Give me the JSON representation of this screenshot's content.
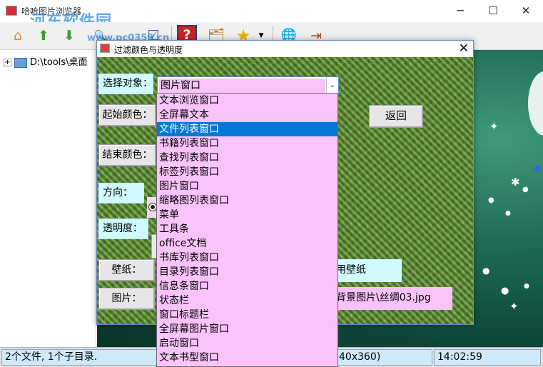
{
  "app": {
    "title": "哈哈图片浏览器",
    "watermark": "河东软件园",
    "watermark_url": "www.pc0359.cn"
  },
  "window_controls": {
    "minimize": "─",
    "maximize": "☐",
    "close": "✕"
  },
  "toolbar": {
    "buttons": [
      {
        "icon": "home-icon",
        "glyph": "⌂"
      },
      {
        "icon": "up-arrow-icon",
        "glyph": "⬆"
      },
      {
        "icon": "down-arrow-icon",
        "glyph": "⬇"
      },
      {
        "icon": "search-icon",
        "glyph": "🔍"
      },
      {
        "icon": "checklist-icon",
        "glyph": "☑"
      },
      {
        "icon": "help-icon",
        "glyph": "?"
      },
      {
        "icon": "search-folder-icon",
        "glyph": "🗂"
      },
      {
        "icon": "star-icon",
        "glyph": "★"
      },
      {
        "icon": "dropdown-arrow-icon",
        "glyph": "▼"
      },
      {
        "icon": "globe-icon",
        "glyph": "🌐"
      },
      {
        "icon": "exit-icon",
        "glyph": "⇥"
      }
    ]
  },
  "tree": {
    "root_label": "D:\\tools\\桌面",
    "expander": "+"
  },
  "status": {
    "files": "2个文件, 1个子目录.",
    "size": "40x360)",
    "time": "14:02:59"
  },
  "dialog": {
    "title": "过滤颜色与透明度",
    "close": "✕",
    "labels": {
      "select_object": "选择对象：",
      "start_color": "起始颜色：",
      "end_color": "结束颜色：",
      "direction": "方向：",
      "transparency": "透明度：",
      "wallpaper": "壁纸：",
      "picture": "图片："
    },
    "combo_value": "图片窗口",
    "combo_arrow": "⌄",
    "back_button": "返回",
    "wallpaper_text": "用壁纸",
    "picture_path": "背景图片\\丝绸03.jpg",
    "dropdown_items": [
      "文本浏览窗口",
      "全屏幕文本",
      "文件列表窗口",
      "书籍列表窗口",
      "查找列表窗口",
      "标签列表窗口",
      "图片窗口",
      "缩略图列表窗口",
      "菜单",
      "工具条",
      "office文档",
      "书库列表窗口",
      "目录列表窗口",
      "信息条窗口",
      "状态栏",
      "窗口标题栏",
      "全屏幕图片窗口",
      "启动窗口",
      "文本书型窗口"
    ],
    "selected_index": 2
  },
  "colors": {
    "selection": "#0078d7",
    "pink": "#f9c3f9",
    "cyan": "#cffaff",
    "status_cell": "#cfe9f8"
  }
}
